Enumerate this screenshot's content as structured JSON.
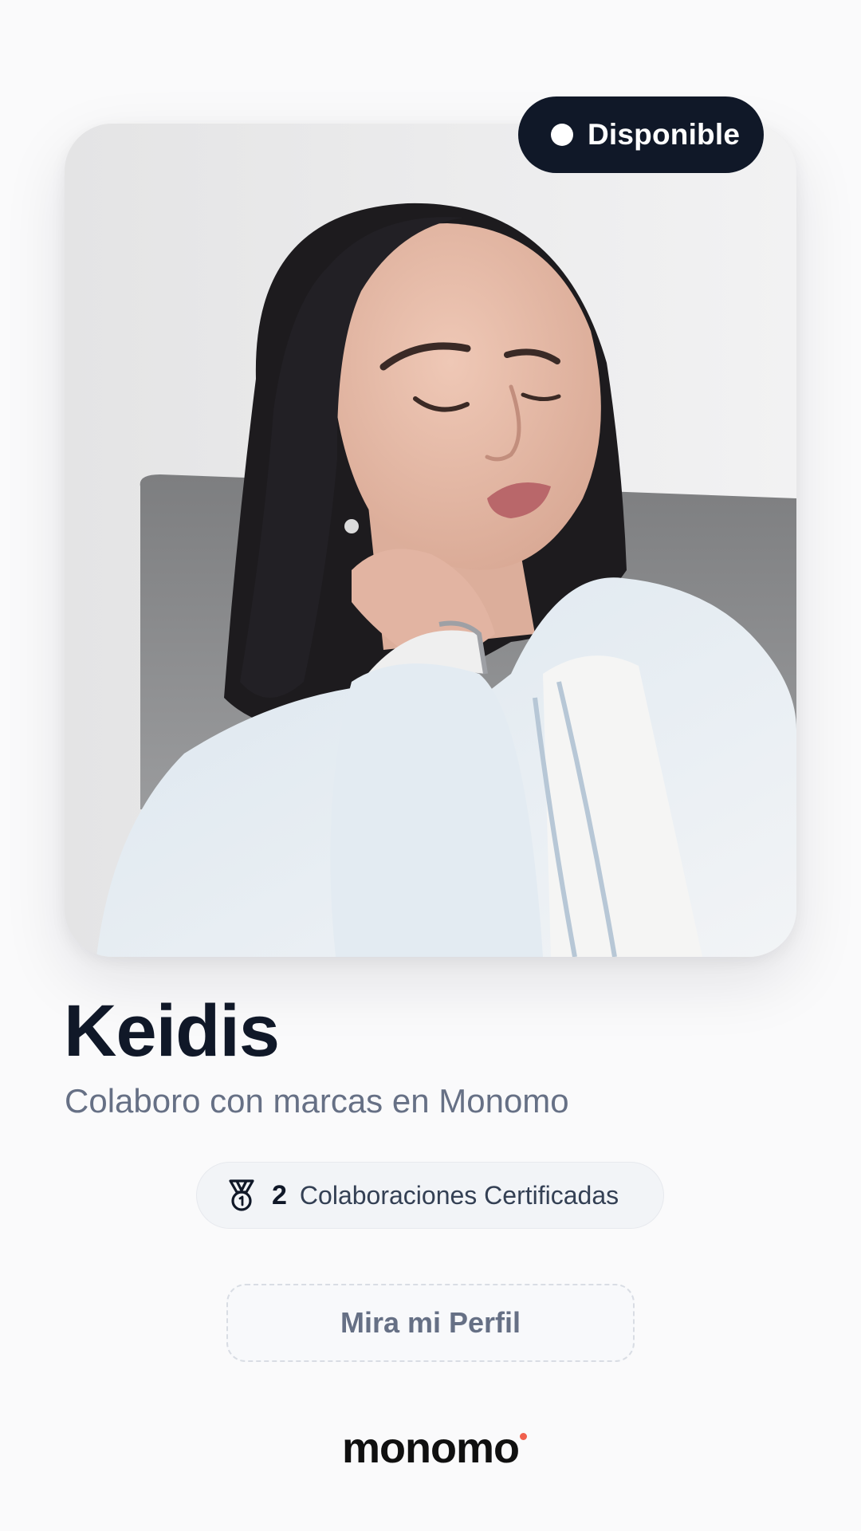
{
  "status": {
    "label": "Disponible"
  },
  "profile": {
    "name": "Keidis",
    "bio": "Colaboro con marcas en Monomo",
    "photo": "profile-photo"
  },
  "collaborations": {
    "count": "2",
    "label": "Colaboraciones Certificadas",
    "icon": "medal-icon"
  },
  "cta": {
    "label": "Mira mi Perfil"
  },
  "brand": {
    "logo_text": "monomo",
    "accent": "#f0604d"
  },
  "colors": {
    "dark": "#101828",
    "muted": "#667085",
    "background": "#fafafb"
  }
}
